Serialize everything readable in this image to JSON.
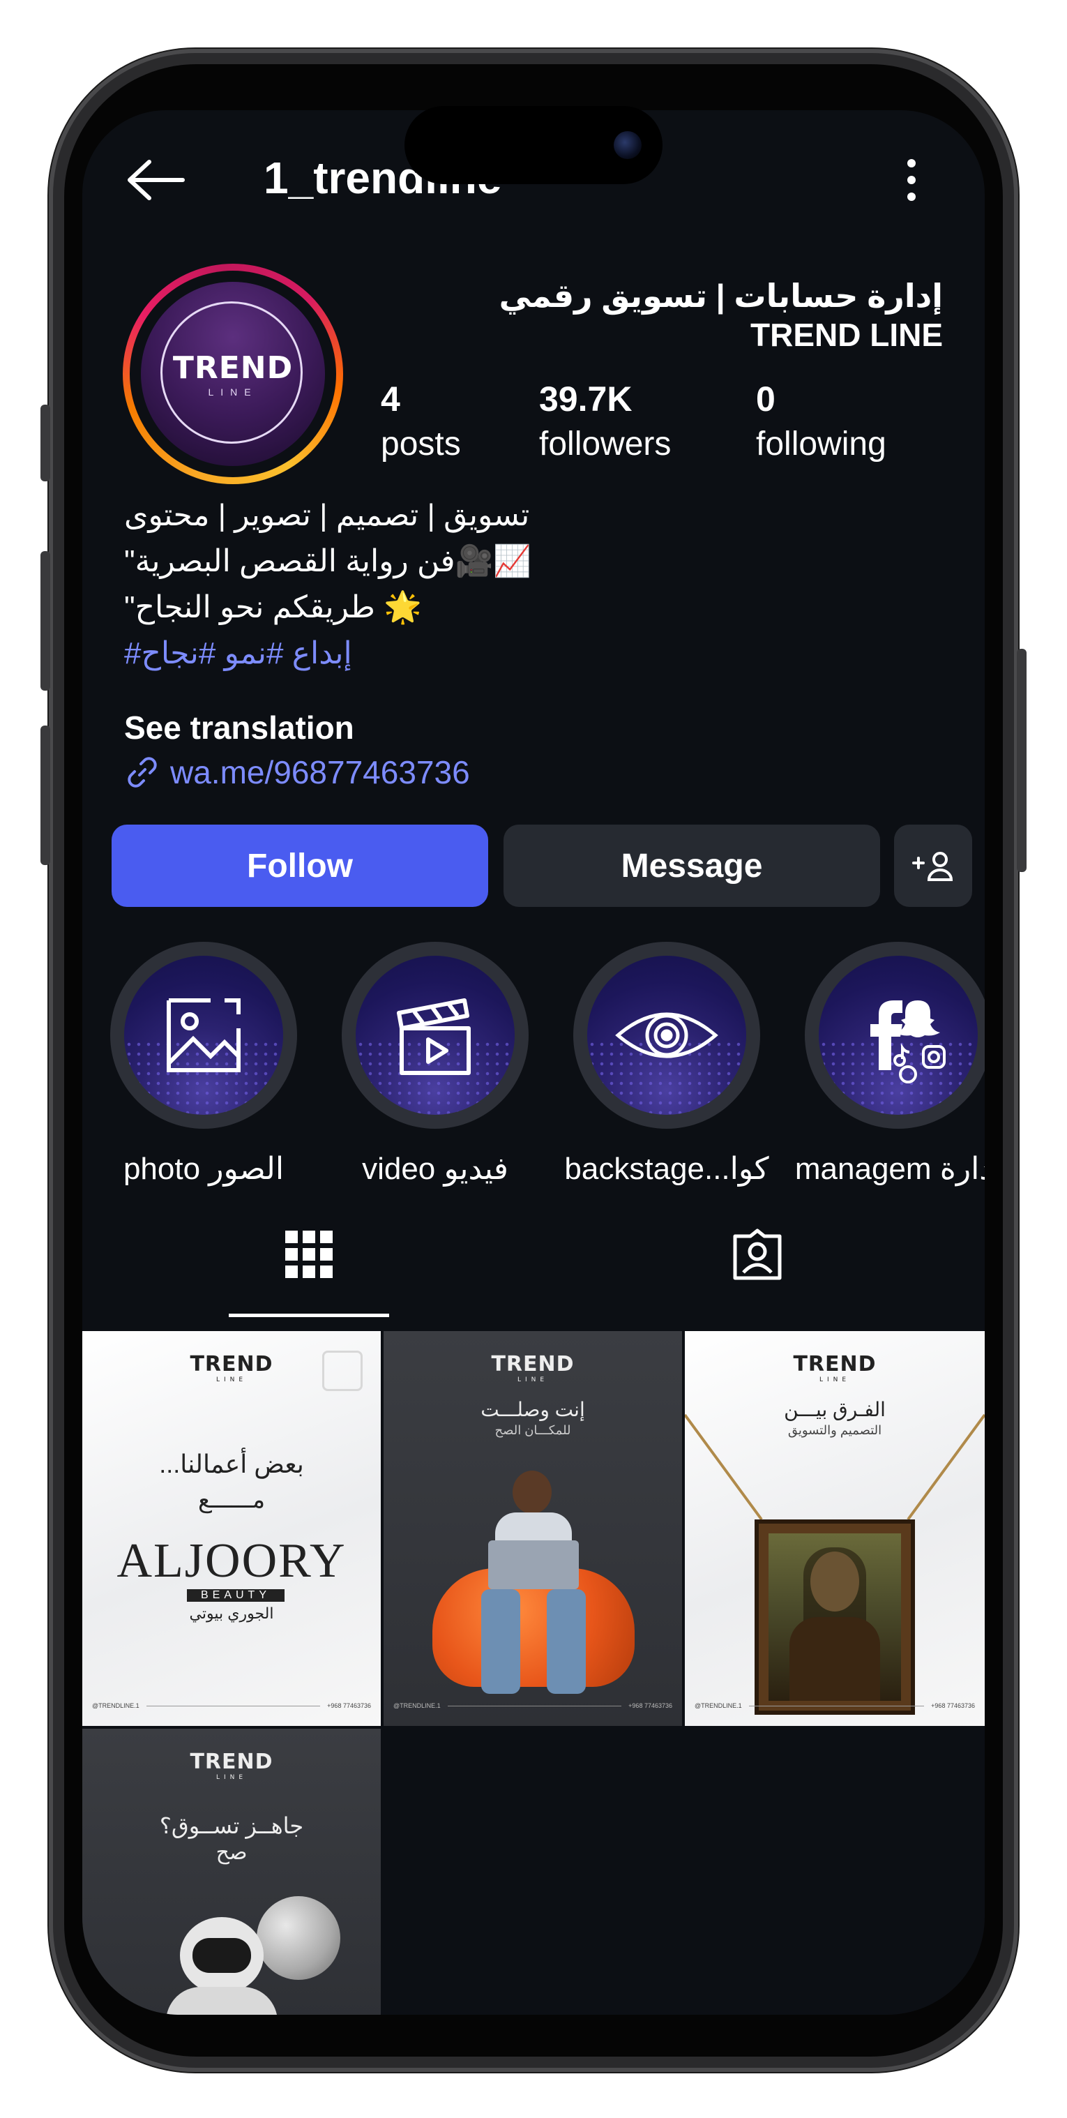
{
  "header": {
    "username": "1_trendline"
  },
  "profile": {
    "full_name": "إدارة حسابات | تسويق رقمي TREND LINE",
    "avatar_logo": {
      "title": "TREND",
      "subtitle": "LINE"
    },
    "stats": [
      {
        "value": "4",
        "label": "posts"
      },
      {
        "value": "39.7K",
        "label": "followers"
      },
      {
        "value": "0",
        "label": "following"
      }
    ],
    "bio": {
      "line1": "تسويق | تصميم | تصوير | محتوى",
      "line2": "📈🎥فن رواية القصص البصرية\"",
      "line3": "🌟 طريقكم نحو النجاح\"",
      "hashtags": "إبداع #نمو #نجاح#"
    },
    "see_translation": "See translation",
    "link": "wa.me/96877463736"
  },
  "actions": {
    "follow": "Follow",
    "message": "Message"
  },
  "highlights": [
    {
      "label": "photo الصور",
      "icon": "image-icon"
    },
    {
      "label": "video فيديو",
      "icon": "clapperboard-icon"
    },
    {
      "label": "backstage...كوا",
      "icon": "eye-icon"
    },
    {
      "label": "managem إدارة",
      "icon": "social-media-icon"
    }
  ],
  "tabs": [
    {
      "name": "posts-grid",
      "icon": "grid-icon",
      "active": true
    },
    {
      "name": "tagged",
      "icon": "tagged-person-icon",
      "active": false
    }
  ],
  "posts": [
    {
      "brand": "TREND",
      "brand_sub": "LINE",
      "headline": "بعض أعمالنا...",
      "sub": "مــــــع",
      "logo": "ALJOORY",
      "logo_sub": "BEAUTY",
      "logo_ar": "الجوري بيوتي",
      "footer_left": "@TRENDLINE.1",
      "footer_right": "+968 77463736",
      "theme": "light"
    },
    {
      "brand": "TREND",
      "brand_sub": "LINE",
      "headline": "إنت وصلـــت",
      "sub": "للمكـــان الصح",
      "footer_left": "@TRENDLINE.1",
      "footer_right": "+968 77463736",
      "theme": "dark"
    },
    {
      "brand": "TREND",
      "brand_sub": "LINE",
      "headline": "الفـرق بيـــن",
      "sub": "التصميم والتسويق",
      "footer_left": "@TRENDLINE.1",
      "footer_right": "+968 77463736",
      "theme": "light"
    },
    {
      "brand": "TREND",
      "brand_sub": "LINE",
      "headline": "جاهــز تســوق؟",
      "sub": "صح",
      "theme": "dark"
    }
  ],
  "colors": {
    "accent": "#4a5cf0",
    "link": "#7d8cff",
    "background": "#0c0f14",
    "button": "#262a31"
  }
}
